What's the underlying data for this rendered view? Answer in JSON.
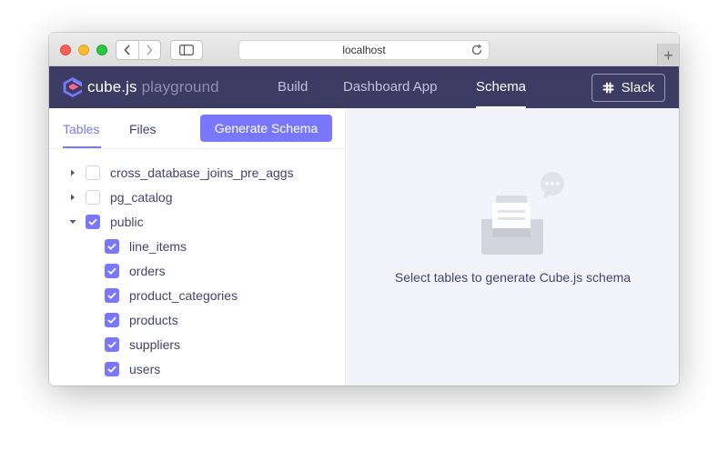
{
  "browser": {
    "address": "localhost",
    "icons": {
      "back": "chevron-left-icon",
      "forward": "chevron-right-icon",
      "sidebar": "sidebar-icon",
      "reload": "reload-icon",
      "new_tab": "plus-icon"
    },
    "new_tab_label": "+"
  },
  "header": {
    "logo_main": "cube.js",
    "logo_sub": "playground",
    "nav": [
      {
        "label": "Build",
        "active": false
      },
      {
        "label": "Dashboard App",
        "active": false
      },
      {
        "label": "Schema",
        "active": true
      }
    ],
    "slack_label": "Slack",
    "colors": {
      "background": "#3b3b64",
      "accent": "#7a77ff"
    }
  },
  "schema_panel": {
    "tabs": [
      {
        "label": "Tables",
        "active": true
      },
      {
        "label": "Files",
        "active": false
      }
    ],
    "generate_button": "Generate Schema",
    "tree": [
      {
        "label": "cross_database_joins_pre_aggs",
        "checked": false,
        "expanded": false,
        "level": 0
      },
      {
        "label": "pg_catalog",
        "checked": false,
        "expanded": false,
        "level": 0
      },
      {
        "label": "public",
        "checked": true,
        "expanded": true,
        "level": 0
      },
      {
        "label": "line_items",
        "checked": true,
        "level": 1
      },
      {
        "label": "orders",
        "checked": true,
        "level": 1
      },
      {
        "label": "product_categories",
        "checked": true,
        "level": 1
      },
      {
        "label": "products",
        "checked": true,
        "level": 1
      },
      {
        "label": "suppliers",
        "checked": true,
        "level": 1
      },
      {
        "label": "users",
        "checked": true,
        "level": 1
      }
    ]
  },
  "empty_state": {
    "message": "Select tables to generate Cube.js schema",
    "icon": "empty-inbox-icon"
  }
}
